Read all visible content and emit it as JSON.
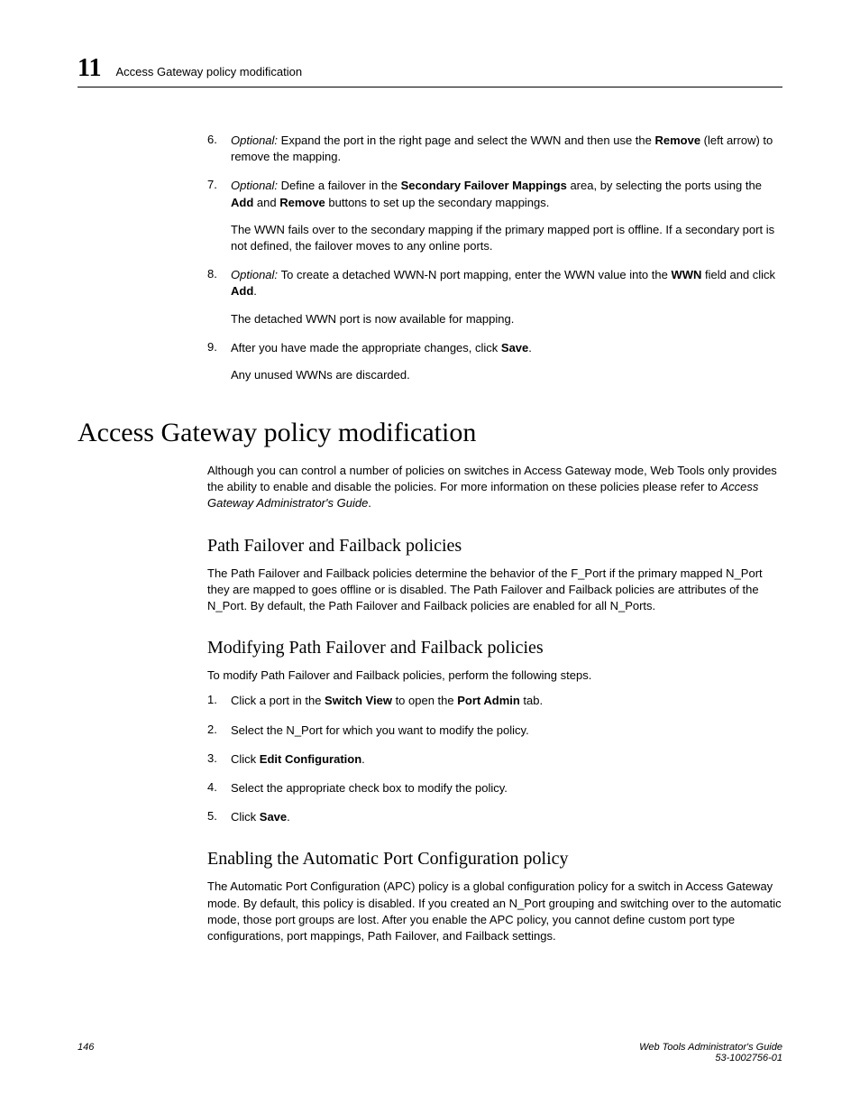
{
  "header": {
    "chapter_num": "11",
    "title": "Access Gateway policy modification"
  },
  "steps_a": [
    {
      "num": "6.",
      "parts": [
        {
          "style": "italic",
          "text": "Optional: "
        },
        {
          "style": "",
          "text": "Expand the port in the right page and select the WWN and then use the "
        },
        {
          "style": "bold",
          "text": "Remove"
        },
        {
          "style": "",
          "text": " (left arrow) to remove the mapping."
        }
      ]
    },
    {
      "num": "7.",
      "parts": [
        {
          "style": "italic",
          "text": "Optional: "
        },
        {
          "style": "",
          "text": "Define a failover in the "
        },
        {
          "style": "bold",
          "text": "Secondary Failover Mappings"
        },
        {
          "style": "",
          "text": " area, by selecting the ports using the "
        },
        {
          "style": "bold",
          "text": "Add"
        },
        {
          "style": "",
          "text": " and "
        },
        {
          "style": "bold",
          "text": "Remove"
        },
        {
          "style": "",
          "text": " buttons to set up the secondary mappings."
        }
      ],
      "sub": "The WWN fails over to the secondary mapping if the primary mapped port is offline. If a secondary port is not defined, the failover moves to any online ports."
    },
    {
      "num": "8.",
      "parts": [
        {
          "style": "italic",
          "text": "Optional: "
        },
        {
          "style": "",
          "text": "To create a detached WWN-N port mapping, enter the WWN value into the "
        },
        {
          "style": "bold",
          "text": "WWN"
        },
        {
          "style": "",
          "text": " field and click "
        },
        {
          "style": "bold",
          "text": "Add"
        },
        {
          "style": "",
          "text": "."
        }
      ],
      "sub": "The detached WWN port is now available for mapping."
    },
    {
      "num": "9.",
      "parts": [
        {
          "style": "",
          "text": "After you have made the appropriate changes, click "
        },
        {
          "style": "bold",
          "text": "Save"
        },
        {
          "style": "",
          "text": "."
        }
      ],
      "sub": "Any unused WWNs are discarded."
    }
  ],
  "section": {
    "title": "Access Gateway policy modification",
    "intro_parts": [
      {
        "style": "",
        "text": "Although you can control a number of policies on switches in Access Gateway mode, Web Tools only provides the ability to enable and disable the policies. For more information on these policies please refer to "
      },
      {
        "style": "italic",
        "text": "Access Gateway Administrator's Guide"
      },
      {
        "style": "",
        "text": "."
      }
    ],
    "sub1": {
      "title": "Path Failover and Failback policies",
      "body": "The Path Failover and Failback policies determine the behavior of the F_Port if the primary mapped N_Port they are mapped to goes offline or is disabled. The Path Failover and Failback policies are attributes of the N_Port. By default, the Path Failover and Failback policies are enabled for all N_Ports."
    },
    "sub2": {
      "title": "Modifying Path Failover and Failback policies",
      "intro": "To modify Path Failover and Failback policies, perform the following steps.",
      "steps": [
        {
          "num": "1.",
          "parts": [
            {
              "style": "",
              "text": "Click a port in the "
            },
            {
              "style": "bold",
              "text": "Switch View"
            },
            {
              "style": "",
              "text": " to open the "
            },
            {
              "style": "bold",
              "text": "Port Admin"
            },
            {
              "style": "",
              "text": " tab."
            }
          ]
        },
        {
          "num": "2.",
          "parts": [
            {
              "style": "",
              "text": "Select the N_Port for which you want to modify the policy."
            }
          ]
        },
        {
          "num": "3.",
          "parts": [
            {
              "style": "",
              "text": "Click "
            },
            {
              "style": "bold",
              "text": "Edit Configuration"
            },
            {
              "style": "",
              "text": "."
            }
          ]
        },
        {
          "num": "4.",
          "parts": [
            {
              "style": "",
              "text": "Select the appropriate check box to modify the policy."
            }
          ]
        },
        {
          "num": "5.",
          "parts": [
            {
              "style": "",
              "text": "Click "
            },
            {
              "style": "bold",
              "text": "Save"
            },
            {
              "style": "",
              "text": "."
            }
          ]
        }
      ]
    },
    "sub3": {
      "title": "Enabling the Automatic Port Configuration policy",
      "body": "The Automatic Port Configuration (APC) policy is a global configuration policy for a switch in Access Gateway mode. By default, this policy is disabled. If you created an N_Port grouping and switching over to the automatic mode, those port groups are lost. After you enable the APC policy, you cannot define custom port type configurations, port mappings, Path Failover, and Failback settings."
    }
  },
  "footer": {
    "page": "146",
    "doc_title": "Web Tools Administrator's Guide",
    "doc_id": "53-1002756-01"
  }
}
